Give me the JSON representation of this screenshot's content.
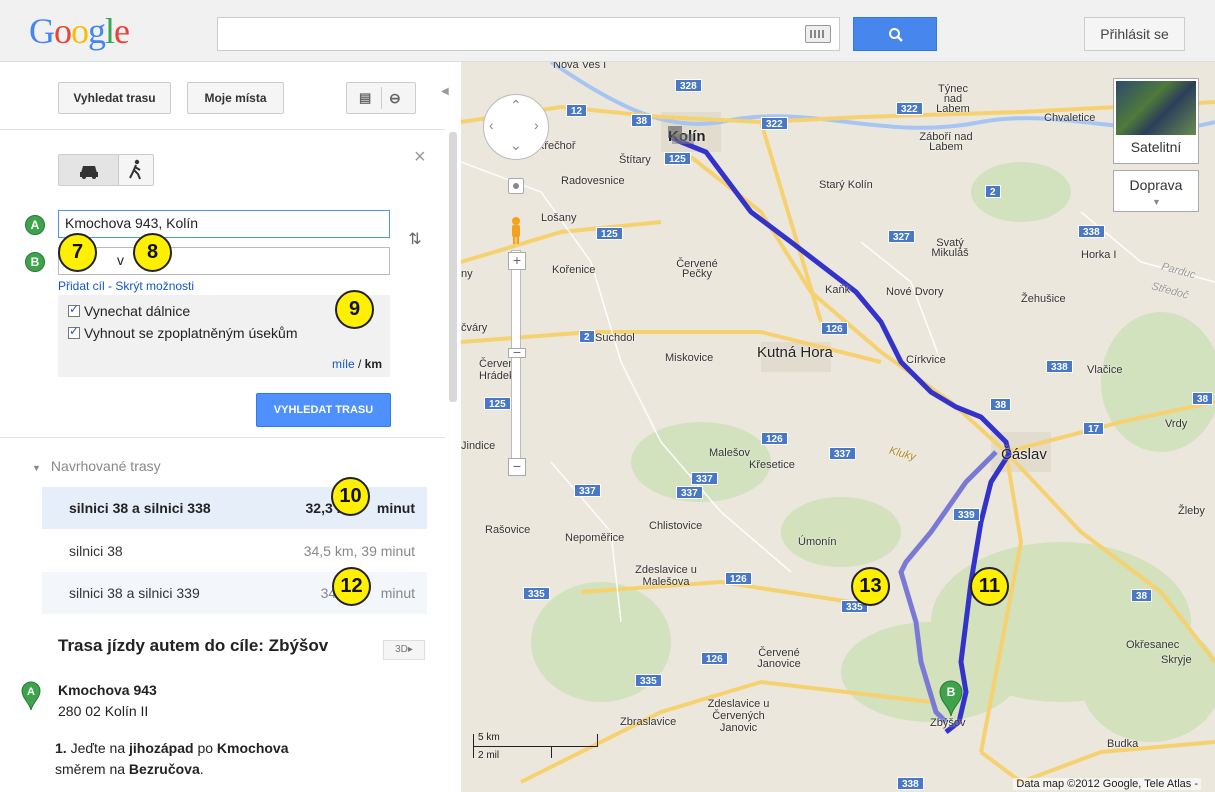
{
  "header": {
    "logo": "Google",
    "search_value": "",
    "signin_label": "Přihlásit se",
    "icons": {
      "keyboard": "keyboard-icon",
      "search": "search-icon"
    },
    "accent_color": "#4787ed"
  },
  "panel": {
    "route_tab_label": "Vyhledat trasu",
    "places_tab_label": "Moje místa",
    "icons": [
      "print-icon",
      "link-icon",
      "collapse-icon"
    ],
    "mode_icons": [
      "car-icon",
      "walk-icon"
    ],
    "close_label": "×",
    "start_marker": "A",
    "end_marker": "B",
    "start_value": "Kmochova 943, Kolín",
    "end_value_visible": "v",
    "links": {
      "add_destination": "Přidat cíl",
      "separator": " - ",
      "hide_options": "Skrýt možnosti"
    },
    "options": {
      "avoid_highways": {
        "label": "Vynechat dálnice",
        "checked": true
      },
      "avoid_tolls": {
        "label": "Vyhnout se zpoplatněným úsekům",
        "checked": true
      },
      "units": {
        "miles": "míle",
        "separator": " / ",
        "km": "km"
      }
    },
    "route_button": "VYHLEDAT TRASU",
    "suggested_header": "Navrhované trasy",
    "routes": [
      {
        "name": "silnici 38 a silnici 338",
        "detail": "32,3 km",
        "detail_tail": "minut",
        "selected": true
      },
      {
        "name": "silnici 38",
        "detail": "34,5 km, 39 minut",
        "selected": false
      },
      {
        "name": "silnici 38 a silnici 339",
        "detail": "34,5 k",
        "detail_tail": "minut",
        "selected": false
      }
    ],
    "directions_title": "Trasa jízdy autem do cíle: Zbýšov",
    "btn_3d": "3D▸",
    "start_address": {
      "line1": "Kmochova 943",
      "line2": "280 02 Kolín II"
    },
    "first_step": {
      "num": "1.",
      "t1": " Jeďte na ",
      "dir": "jihozápad",
      "t2": " po ",
      "street": "Kmochova",
      "t3": "směrem na ",
      "target": "Bezručova",
      "t4": "."
    }
  },
  "map": {
    "satellite_label": "Satelitní",
    "traffic_label": "Doprava",
    "scale": {
      "km": "5 km",
      "mi": "2 mil"
    },
    "copyright": "Data map ©2012 Google, Tele Atlas -",
    "route_color": "#3333cc",
    "alt_route_color": "#7a7ad6",
    "places": [
      "Nova Ves I",
      "Kolín",
      "Týnec nad Labem",
      "Záboří nad Labem",
      "Chvaletice",
      "Křečhoř",
      "Štítary",
      "Radovesnice",
      "Starý Kolín",
      "Lošany",
      "Svatý Mikuláš",
      "Horka I",
      "Kořenice",
      "Červené Pečky",
      "Kaňk",
      "Nové Dvory",
      "Žehušice",
      "Parduc",
      "Středoč",
      "čváry",
      "Suchdol",
      "Miskovice",
      "Kutná Hora",
      "Církvice",
      "Vlačice",
      "Červený Hrádek",
      "Vrdy",
      "Jindice",
      "Malešov",
      "Křesetice",
      "Kluky",
      "Čáslav",
      "Rašovice",
      "Chlistovice",
      "Úmonín",
      "Žleby",
      "Nepoměřice",
      "Zdeslavice u Malešova",
      "Okřesanec",
      "Skryje",
      "Červené Janovice",
      "Zbraslavice",
      "Zdeslavice u Červených Janovic",
      "Zbýšov",
      "Budka",
      "ny"
    ],
    "road_numbers": [
      "328",
      "12",
      "38",
      "322",
      "125",
      "2",
      "327",
      "338",
      "126",
      "38",
      "17",
      "126",
      "337",
      "337",
      "337",
      "338",
      "339",
      "335",
      "335",
      "126",
      "338",
      "335",
      "38",
      "2",
      "322",
      "125",
      "38",
      "125",
      "126",
      "337"
    ],
    "route_markers": [
      "A",
      "B"
    ]
  },
  "callouts": [
    "7",
    "8",
    "9",
    "10",
    "11",
    "12",
    "13"
  ]
}
